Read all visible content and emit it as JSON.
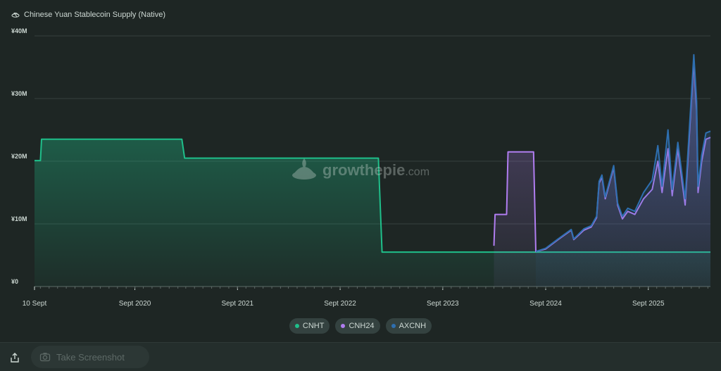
{
  "title": "Chinese Yuan Stablecoin Supply (Native)",
  "watermark": {
    "brand": "growthepie",
    "suffix": ".com"
  },
  "legend": [
    {
      "label": "CNHT",
      "color": "#1fbf8a"
    },
    {
      "label": "CNH24",
      "color": "#b07df0"
    },
    {
      "label": "AXCNH",
      "color": "#2e6fb0"
    }
  ],
  "bottom_bar": {
    "screenshot_label": "Take Screenshot"
  },
  "icons": {
    "title_icon": "stablecoin-icon",
    "share": "share-icon",
    "camera": "camera-icon"
  },
  "chart_data": {
    "type": "area",
    "title": "Chinese Yuan Stablecoin Supply (Native)",
    "y_unit": "¥M",
    "ylim": [
      0,
      40
    ],
    "y_ticks": [
      "¥0",
      "¥10M",
      "¥20M",
      "¥30M",
      "¥40M"
    ],
    "y_tick_values": [
      0,
      10,
      20,
      30,
      40
    ],
    "x_range": [
      "2019-09-10",
      "2026-04-10"
    ],
    "x_ticks": [
      {
        "label": "10 Sept",
        "date": "2019-09-10"
      },
      {
        "label": "Sept 2020",
        "date": "2020-09-01"
      },
      {
        "label": "Sept 2021",
        "date": "2021-09-01"
      },
      {
        "label": "Sept 2022",
        "date": "2022-09-01"
      },
      {
        "label": "Sept 2023",
        "date": "2023-09-01"
      },
      {
        "label": "Sept 2024",
        "date": "2024-09-01"
      },
      {
        "label": "Sept 2025",
        "date": "2025-09-01"
      }
    ],
    "grid": true,
    "legend_position": "bottom-center",
    "series": [
      {
        "name": "CNHT",
        "color": "#1fbf8a",
        "points": [
          [
            "2019-09-10",
            20.1
          ],
          [
            "2019-10-01",
            20.1
          ],
          [
            "2019-10-05",
            23.5
          ],
          [
            "2021-02-15",
            23.5
          ],
          [
            "2021-02-25",
            20.5
          ],
          [
            "2023-01-15",
            20.5
          ],
          [
            "2023-01-28",
            5.5
          ],
          [
            "2026-04-10",
            5.5
          ]
        ]
      },
      {
        "name": "CNH24",
        "color": "#b07df0",
        "points": [
          [
            "2024-03-01",
            6.5
          ],
          [
            "2024-03-05",
            11.5
          ],
          [
            "2024-04-15",
            11.5
          ],
          [
            "2024-04-20",
            21.5
          ],
          [
            "2024-07-20",
            21.5
          ],
          [
            "2024-07-28",
            5.6
          ],
          [
            "2024-09-01",
            6.0
          ],
          [
            "2024-10-15",
            7.5
          ],
          [
            "2024-12-01",
            9.0
          ],
          [
            "2024-12-10",
            7.5
          ],
          [
            "2025-01-15",
            9.0
          ],
          [
            "2025-02-10",
            9.5
          ],
          [
            "2025-03-01",
            11.0
          ],
          [
            "2025-03-10",
            16.5
          ],
          [
            "2025-03-20",
            17.5
          ],
          [
            "2025-04-01",
            14.0
          ],
          [
            "2025-05-01",
            19.0
          ],
          [
            "2025-05-15",
            13.0
          ],
          [
            "2025-06-01",
            10.8
          ],
          [
            "2025-06-20",
            12.0
          ],
          [
            "2025-07-15",
            11.5
          ],
          [
            "2025-08-15",
            14.0
          ],
          [
            "2025-09-15",
            15.5
          ],
          [
            "2025-10-05",
            20.0
          ],
          [
            "2025-10-20",
            15.0
          ],
          [
            "2025-11-10",
            22.0
          ],
          [
            "2025-11-25",
            14.5
          ],
          [
            "2025-12-15",
            22.0
          ],
          [
            "2026-01-10",
            13.0
          ],
          [
            "2026-02-10",
            36.0
          ],
          [
            "2026-02-20",
            28.0
          ],
          [
            "2026-02-25",
            15.0
          ],
          [
            "2026-03-10",
            20.0
          ],
          [
            "2026-03-25",
            23.5
          ],
          [
            "2026-04-10",
            23.8
          ]
        ]
      },
      {
        "name": "AXCNH",
        "color": "#2e6fb0",
        "points": [
          [
            "2024-07-28",
            5.6
          ],
          [
            "2024-09-01",
            6.1
          ],
          [
            "2024-10-15",
            7.6
          ],
          [
            "2024-12-01",
            9.1
          ],
          [
            "2024-12-10",
            7.6
          ],
          [
            "2025-01-15",
            9.2
          ],
          [
            "2025-02-10",
            9.7
          ],
          [
            "2025-03-01",
            11.2
          ],
          [
            "2025-03-10",
            16.8
          ],
          [
            "2025-03-20",
            17.8
          ],
          [
            "2025-04-01",
            14.3
          ],
          [
            "2025-05-01",
            19.3
          ],
          [
            "2025-05-15",
            13.3
          ],
          [
            "2025-06-01",
            11.2
          ],
          [
            "2025-06-20",
            12.5
          ],
          [
            "2025-07-15",
            12.0
          ],
          [
            "2025-08-15",
            15.0
          ],
          [
            "2025-09-15",
            17.0
          ],
          [
            "2025-10-05",
            22.5
          ],
          [
            "2025-10-20",
            16.0
          ],
          [
            "2025-11-10",
            25.0
          ],
          [
            "2025-11-25",
            15.5
          ],
          [
            "2025-12-15",
            23.0
          ],
          [
            "2026-01-10",
            14.0
          ],
          [
            "2026-02-10",
            37.0
          ],
          [
            "2026-02-20",
            29.5
          ],
          [
            "2026-02-25",
            16.0
          ],
          [
            "2026-03-10",
            21.0
          ],
          [
            "2026-03-25",
            24.5
          ],
          [
            "2026-04-10",
            24.8
          ]
        ]
      }
    ]
  }
}
